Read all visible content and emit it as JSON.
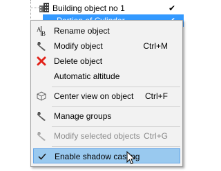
{
  "tree": {
    "items": [
      {
        "label": "Building object no 1",
        "check": "✔"
      },
      {
        "label": "Portion of Cylinder",
        "check": "✔"
      }
    ]
  },
  "menu": {
    "rename": {
      "label": "Rename object",
      "icon": "rename-ab-icon"
    },
    "modify": {
      "label": "Modify object",
      "shortcut": "Ctrl+M",
      "icon": "wrench-icon"
    },
    "delete": {
      "label": "Delete object",
      "icon": "red-x-icon"
    },
    "altitude": {
      "label": "Automatic altitude"
    },
    "center": {
      "label": "Center view on object",
      "shortcut": "Ctrl+F",
      "icon": "cube-icon"
    },
    "groups": {
      "label": "Manage groups",
      "icon": "wrench-icon"
    },
    "modify_selected": {
      "label": "Modify selected objects",
      "shortcut": "Ctrl+G",
      "icon": "wrench-icon",
      "disabled": true
    },
    "shadow": {
      "label": "Enable shadow casting",
      "icon": "checkmark-icon",
      "checked": true,
      "highlighted": true
    }
  },
  "colors": {
    "selection": "#3399ff",
    "highlight": "#99c9ef",
    "delete_icon": "#e2231a"
  }
}
